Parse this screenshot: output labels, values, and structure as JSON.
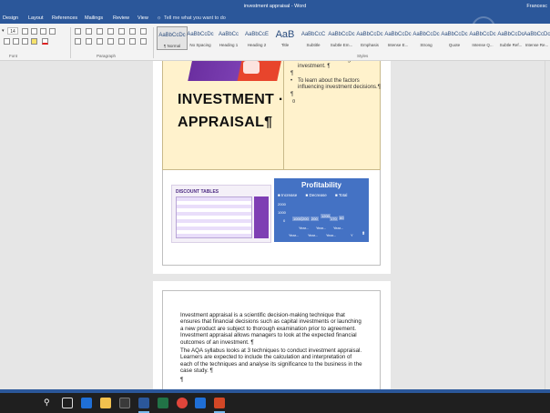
{
  "window": {
    "title": "investment appraisal - Word",
    "user": "Francesc"
  },
  "tabs": [
    "Design",
    "Layout",
    "References",
    "Mailings",
    "Review",
    "View"
  ],
  "tell_me": "Tell me what you want to do",
  "ribbon": {
    "font_size": "14",
    "group_font": "Font",
    "group_paragraph": "Paragraph",
    "group_styles": "Styles",
    "styles": [
      {
        "preview": "AaBbCcDc",
        "name": "¶ Normal"
      },
      {
        "preview": "AaBbCcDc",
        "name": "No Spacing"
      },
      {
        "preview": "AaBbCc",
        "name": "Heading 1"
      },
      {
        "preview": "AaBbCcE",
        "name": "Heading 2"
      },
      {
        "preview": "AaB",
        "name": "Title"
      },
      {
        "preview": "AaBbCcC",
        "name": "Subtitle"
      },
      {
        "preview": "AaBbCcDc",
        "name": "Subtle Em..."
      },
      {
        "preview": "AaBbCcDc",
        "name": "Emphasis"
      },
      {
        "preview": "AaBbCcDc",
        "name": "Intense E..."
      },
      {
        "preview": "AaBbCcDc",
        "name": "Strong"
      },
      {
        "preview": "AaBbCcDc",
        "name": "Quote"
      },
      {
        "preview": "AaBbCcDc",
        "name": "Intense Q..."
      },
      {
        "preview": "AaBbCcDc",
        "name": "Subtle Ref..."
      },
      {
        "preview": "AaBbCcDc",
        "name": "Intense Re..."
      }
    ]
  },
  "page1": {
    "title_line1": "INVESTMENT ·",
    "title_line2": "APPRAISAL¶",
    "right_line1": "methods of assessing an investment. ¶",
    "right_line2": "¶",
    "right_bullet": "To learn about the factors influencing investment decisions.¶",
    "right_line3": "¶",
    "right_line4": "¤",
    "image_label": "DISCOUNT TABLES"
  },
  "chart_data": {
    "type": "bar",
    "title": "Profitability",
    "legend": [
      "Increase",
      "Decrease",
      "Total"
    ],
    "y_ticks": [
      "2000",
      "1000",
      "0"
    ],
    "bar_labels": [
      "1000",
      "200",
      "200",
      "1200",
      "170",
      "60"
    ],
    "categories": [
      "Year...",
      "Year...",
      "Year...",
      "Year...",
      "Year...",
      "Year...",
      "Y"
    ]
  },
  "page2": {
    "para1": "Investment appraisal is a scientific decision-making technique that ensures that financial decisions such as capital investments or launching a new product are subject to thorough examination prior to agreement. Investment appraisal allows managers to look at the expected financial outcomes of an investment. ¶",
    "para2": "The AQA syllabus looks at 3 techniques to conduct investment appraisal. Learners are expected to include the calculation and interpretation of each of the techniques and analyse its significance to the business in the case study. ¶",
    "para3": "¶"
  },
  "colors": {
    "accent": "#2b579a",
    "chart": "#4472c4",
    "table_fill": "#fff2cc"
  }
}
